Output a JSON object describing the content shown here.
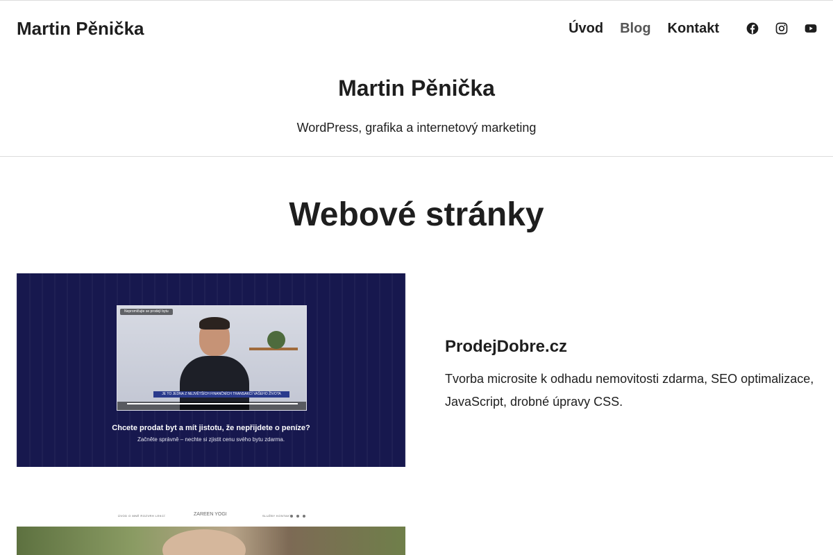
{
  "header": {
    "site_title": "Martin Pěnička",
    "nav": [
      {
        "label": "Úvod"
      },
      {
        "label": "Blog"
      },
      {
        "label": "Kontakt"
      }
    ],
    "social": [
      "facebook-icon",
      "instagram-icon",
      "youtube-icon"
    ]
  },
  "hero": {
    "title": "Martin Pěnička",
    "tagline": "WordPress, grafika a internetový marketing"
  },
  "section": {
    "title": "Webové stránky"
  },
  "projects": [
    {
      "name": "ProdejDobre.cz",
      "description": "Tvorba microsite k odhadu nemovitosti zdarma, SEO optimalizace, JavaScript, drobné úpravy CSS.",
      "image": {
        "headline": "Chcete prodat byt a mít jistotu, že nepřijdete o peníze?",
        "sub": "Začněte správně – nechte si zjistit cenu svého bytu zdarma.",
        "video_caption": "JE TO JEDNA Z NEJVĚTŠÍCH FINANČNÍCH TRANSAKCÍ VAŠEHO ŽIVOTA",
        "video_chip": "Nepromlčujte se prodejí bytu"
      }
    },
    {
      "image": {
        "nav_left": "ÚVOD   O MNĚ   ROZVRH LEKCÍ",
        "logo": "ZAREEN YOGI",
        "nav_right": "SLUŽBY   KONTAKT"
      }
    }
  ],
  "colors": {
    "text": "#1e1e1e",
    "nav_active": "#555555",
    "divider": "#dcdcdc",
    "hero_bg": "#17184e"
  }
}
